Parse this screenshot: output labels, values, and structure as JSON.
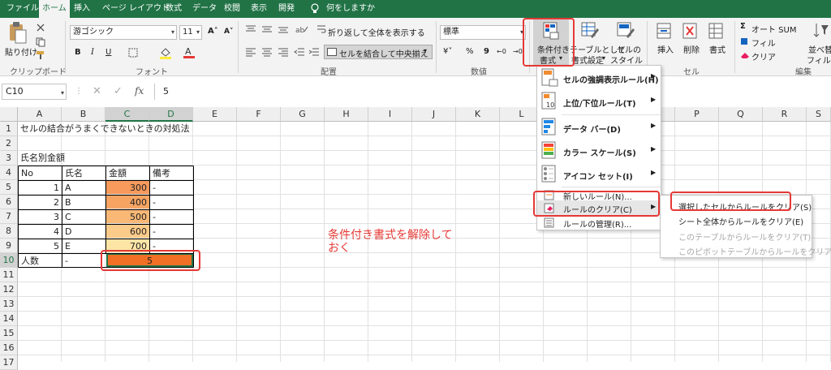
{
  "tabs": {
    "file": "ファイル",
    "home": "ホーム",
    "insert": "挿入",
    "page_layout": "ページ レイアウト",
    "formulas": "数式",
    "data": "データ",
    "review": "校閲",
    "view": "表示",
    "developer": "開発",
    "tell_me": "何をしますか"
  },
  "ribbon": {
    "paste": "貼り付け",
    "clipboard": "クリップボード",
    "font_name": "游ゴシック",
    "font_size": "11",
    "font_group": "フォント",
    "wrap_text": "折り返して全体を表示する",
    "merge_center": "セルを結合して中央揃え",
    "alignment_group": "配置",
    "number_format": "標準",
    "number_group": "数値",
    "cond_format_1": "条件付き",
    "cond_format_2": "書式",
    "table_format_1": "テーブルとして",
    "table_format_2": "書式設定",
    "cell_style_1": "セルの",
    "cell_style_2": "スタイル",
    "insert": "挿入",
    "delete": "削除",
    "format": "書式",
    "cells_group": "セル",
    "autosum": "オート SUM",
    "fill": "フィル",
    "clear": "クリア",
    "editing_group": "編集",
    "sort_filter_1": "並べ替",
    "sort_filter_2": "フィルタ"
  },
  "formula_bar": {
    "name_box": "C10",
    "fx": "fx",
    "value": "5"
  },
  "columns": [
    "A",
    "B",
    "C",
    "D",
    "E",
    "F",
    "G",
    "H",
    "I",
    "J",
    "K",
    "L",
    "M",
    "N",
    "O",
    "P",
    "Q",
    "R",
    "S"
  ],
  "rows": [
    "1",
    "2",
    "3",
    "4",
    "5",
    "6",
    "7",
    "8",
    "9",
    "10",
    "11",
    "12",
    "13",
    "14",
    "15",
    "16",
    "17"
  ],
  "sheet": {
    "title": "セルの結合がうまくできないときの対処法",
    "subtitle": "氏名別金額",
    "headers": [
      "No",
      "氏名",
      "金額",
      "備考"
    ],
    "records": [
      {
        "no": "1",
        "name": "A",
        "amount": "300",
        "note": "-"
      },
      {
        "no": "2",
        "name": "B",
        "amount": "400",
        "note": "-"
      },
      {
        "no": "3",
        "name": "C",
        "amount": "500",
        "note": "-"
      },
      {
        "no": "4",
        "name": "D",
        "amount": "600",
        "note": "-"
      },
      {
        "no": "5",
        "name": "E",
        "amount": "700",
        "note": "-"
      }
    ],
    "total_label": "人数",
    "total_b": "-",
    "total_value": "5"
  },
  "annotation": {
    "line1": "条件付き書式を解除して",
    "line2": "おく"
  },
  "cf_menu": {
    "highlight": "セルの強調表示ルール(H)",
    "topbottom": "上位/下位ルール(T)",
    "databar": "データ バー(D)",
    "colorscale": "カラー スケール(S)",
    "iconset": "アイコン セット(I)",
    "new_rule": "新しいルール(N)...",
    "clear_rules": "ルールのクリア(C)",
    "manage": "ルールの管理(R)..."
  },
  "clear_menu": {
    "selected": "選択したセルからルールをクリア(S)",
    "sheet": "シート全体からルールをクリア(E)",
    "table": "このテーブルからルールをクリア(T)",
    "pivot": "このピボットテーブルからルールをクリア(P)"
  },
  "colors": {
    "excel_green": "#217346",
    "highlight_red": "#e53935",
    "amount_300": "#f79a5c",
    "amount_400": "#f7a463",
    "amount_500": "#f9b876",
    "amount_600": "#fbcb8a",
    "amount_700": "#fde5a6",
    "merged": "#f26f26"
  }
}
